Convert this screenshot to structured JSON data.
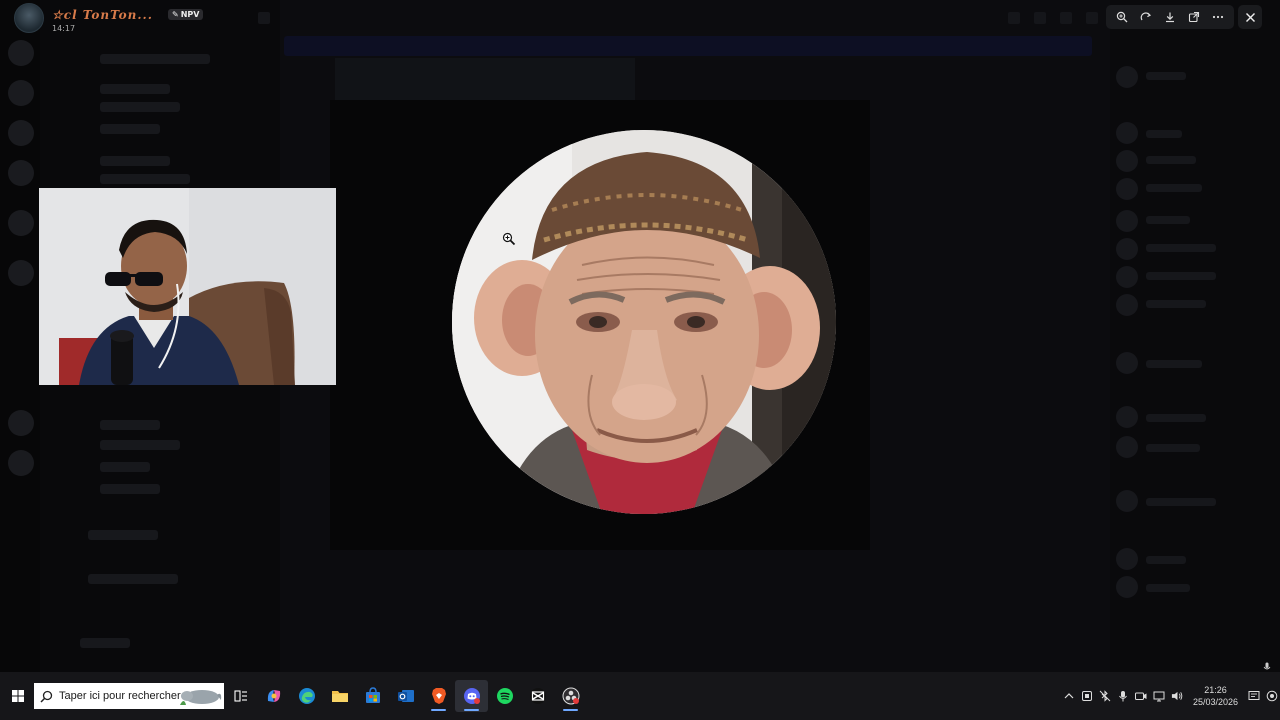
{
  "profile": {
    "name": "☆cl TonTon...",
    "time": "14:17",
    "badge": "NPV"
  },
  "viewer": {
    "tools": [
      "zoom-in-icon",
      "rotate-icon",
      "download-icon",
      "open-external-icon",
      "more-icon"
    ],
    "close_icon": "close-icon"
  },
  "taskbar": {
    "search_placeholder": "Taper ici pour rechercher",
    "apps": [
      "task-view-icon",
      "copilot-icon",
      "edge-icon",
      "file-explorer-icon",
      "microsoft-store-icon",
      "outlook-icon",
      "brave-icon",
      "discord-icon",
      "spotify-icon",
      "capcut-icon",
      "obs-icon"
    ],
    "clock_time": "21:26",
    "clock_date": "25/03/2026"
  },
  "colors": {
    "taskbar_bg": "#161619",
    "toolbar_bg": "#1a1b1e",
    "profile_name": "#d87b4a",
    "active_indicator": "#6fa8ff"
  }
}
